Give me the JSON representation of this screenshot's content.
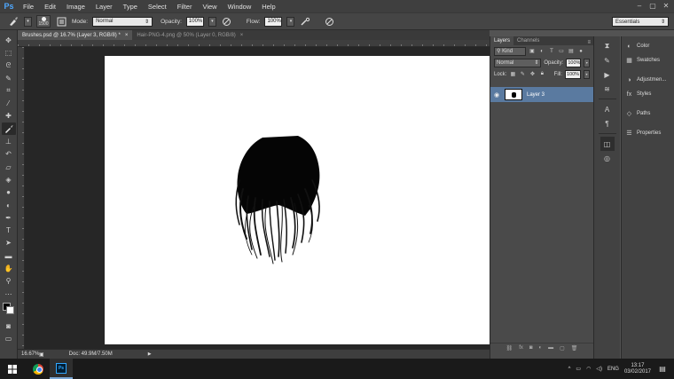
{
  "app": {
    "logo": "Ps"
  },
  "menu": [
    "File",
    "Edit",
    "Image",
    "Layer",
    "Type",
    "Select",
    "Filter",
    "View",
    "Window",
    "Help"
  ],
  "window_controls": [
    "–",
    "▢",
    "✕"
  ],
  "options": {
    "brush_size": "1500",
    "mode_label": "Mode:",
    "mode_value": "Normal",
    "opacity_label": "Opacity:",
    "opacity_value": "100%",
    "flow_label": "Flow:",
    "flow_value": "100%",
    "workspace": "Essentials"
  },
  "doc_tabs": [
    {
      "title": "Brushes.psd @ 16.7% (Layer 3, RGB/8) *",
      "close": "×",
      "active": true
    },
    {
      "title": "Hair-PNG-4.png @ 50% (Layer 0, RGB/8)",
      "close": "×",
      "active": false
    }
  ],
  "status": {
    "zoom": "16.67%",
    "doc": "Doc: 49.9M/7.50M"
  },
  "layers_panel": {
    "tabs": [
      "Layers",
      "Channels"
    ],
    "kind_label": "Kind",
    "blend_mode": "Normal",
    "opacity_label": "Opacity:",
    "opacity_value": "100%",
    "lock_label": "Lock:",
    "fill_label": "Fill:",
    "fill_value": "100%",
    "layers": [
      {
        "name": "Layer 3",
        "visible": true,
        "selected": true
      }
    ]
  },
  "dock_panels": [
    {
      "label": "Color",
      "icon": "color-icon"
    },
    {
      "label": "Swatches",
      "icon": "swatches-icon"
    },
    {
      "label": "Adjustmen...",
      "icon": "adjustments-icon"
    },
    {
      "label": "Styles",
      "icon": "styles-icon"
    },
    {
      "label": "Paths",
      "icon": "paths-icon"
    },
    {
      "label": "Properties",
      "icon": "properties-icon"
    }
  ],
  "taskbar": {
    "language": "ENG",
    "time": "13:17",
    "date": "03/02/2017"
  },
  "colors": {
    "accent": "#5a7aa0",
    "canvas": "#ffffff",
    "workspace_bg": "#262626",
    "ps_blue": "#31a8ff"
  }
}
